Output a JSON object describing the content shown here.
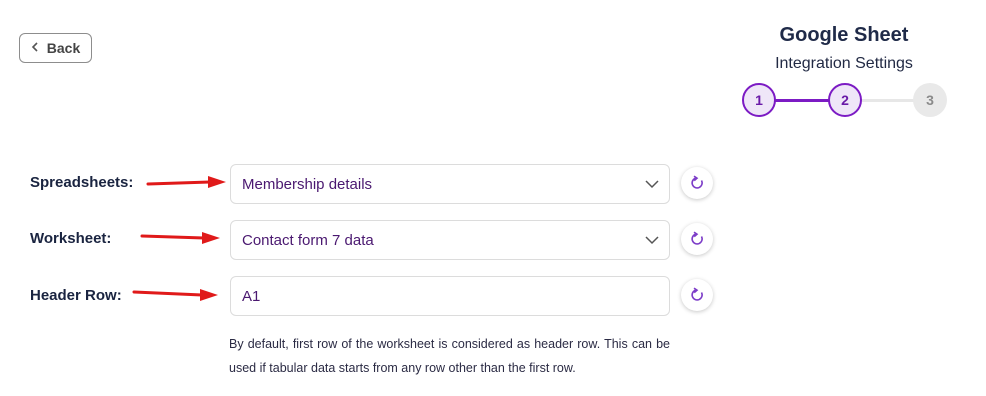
{
  "back_button": {
    "label": "Back",
    "icon": "chevron-left-icon"
  },
  "header": {
    "title": "Google Sheet",
    "subtitle": "Integration Settings"
  },
  "stepper": {
    "steps": [
      {
        "number": "1",
        "state": "done"
      },
      {
        "number": "2",
        "state": "current"
      },
      {
        "number": "3",
        "state": "pending"
      }
    ],
    "accent_color": "#7c1bc4"
  },
  "form": {
    "spreadsheets": {
      "label": "Spreadsheets:",
      "value": "Membership details"
    },
    "worksheet": {
      "label": "Worksheet:",
      "value": "Contact form 7 data"
    },
    "header_row": {
      "label": "Header Row:",
      "value": "A1"
    },
    "help_text": "By default, first row of the worksheet is considered as header row. This can be used if tabular data starts from any row other than the first row."
  },
  "icons": {
    "refresh": "refresh-icon",
    "dropdown": "chevron-down-icon",
    "annotation": "red-arrow-icon"
  }
}
